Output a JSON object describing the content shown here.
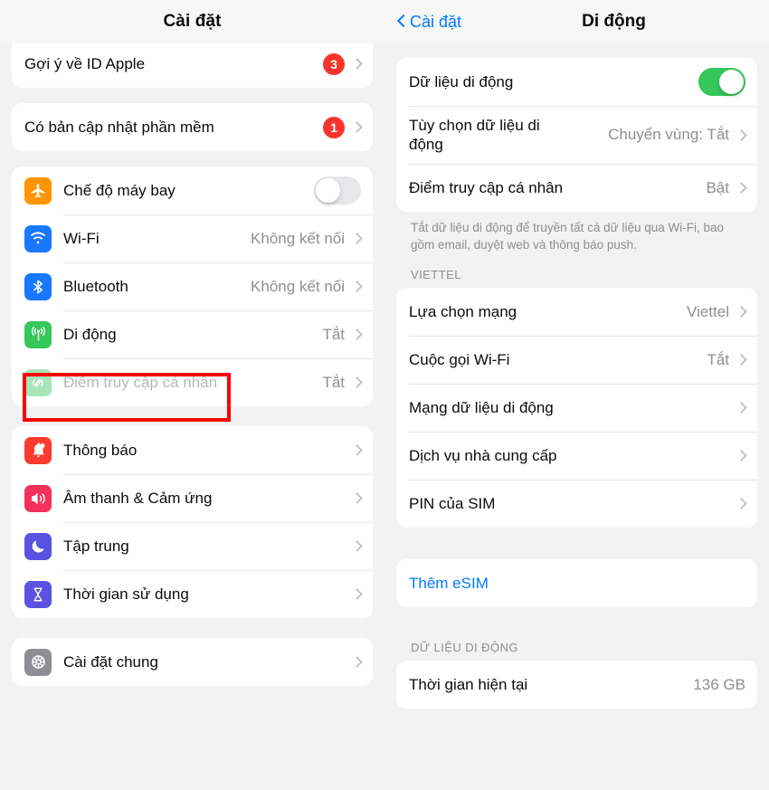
{
  "left_panel": {
    "nav": {
      "title": "Cài đặt"
    },
    "groups": [
      {
        "name": "apple-id-suggestion",
        "rows": [
          {
            "label": "Gợi ý về ID Apple",
            "badge": "3",
            "chevron": true
          }
        ]
      },
      {
        "name": "software-update",
        "rows": [
          {
            "label": "Có bản cập nhật phần mềm",
            "badge": "1",
            "chevron": true
          }
        ]
      },
      {
        "name": "connectivity",
        "rows": [
          {
            "label": "Chế độ máy bay",
            "icon": "airplane-icon",
            "toggle": "off"
          },
          {
            "label": "Wi-Fi",
            "icon": "wifi-icon",
            "value": "Không kết nối",
            "chevron": true
          },
          {
            "label": "Bluetooth",
            "icon": "bluetooth-icon",
            "value": "Không kết nối",
            "chevron": true
          },
          {
            "label": "Di động",
            "icon": "cellular-icon",
            "value": "Tắt",
            "chevron": true
          },
          {
            "label": "Điểm truy cập cá nhân",
            "icon": "hotspot-icon",
            "value": "Tắt",
            "chevron": true,
            "dim": true
          }
        ]
      },
      {
        "name": "notifications",
        "rows": [
          {
            "label": "Thông báo",
            "icon": "bell-icon",
            "chevron": true
          },
          {
            "label": "Âm thanh & Cảm ứng",
            "icon": "speaker-icon",
            "chevron": true
          },
          {
            "label": "Tập trung",
            "icon": "moon-icon",
            "chevron": true
          },
          {
            "label": "Thời gian sử dụng",
            "icon": "hourglass-icon",
            "chevron": true
          }
        ]
      },
      {
        "name": "general",
        "rows": [
          {
            "label": "Cài đặt chung",
            "icon": "gear-icon",
            "chevron": true
          }
        ]
      }
    ]
  },
  "right_panel": {
    "nav": {
      "back_label": "Cài đặt",
      "title": "Di động"
    },
    "groups": [
      {
        "name": "cellular-data",
        "rows": [
          {
            "label": "Dữ liệu di động",
            "toggle": "on"
          },
          {
            "label": "Tùy chọn dữ liệu di động",
            "value": "Chuyển vùng: Tắt",
            "chevron": true,
            "two_line": true
          },
          {
            "label": "Điểm truy cập cá nhân",
            "value": "Bật",
            "chevron": true
          }
        ],
        "footnote": "Tắt dữ liệu di động để truyền tất cả dữ liệu qua Wi-Fi, bao gồm email, duyệt web và thông báo push."
      },
      {
        "name": "viettel",
        "header": "VIETTEL",
        "rows": [
          {
            "label": "Lựa chọn mạng",
            "value": "Viettel",
            "chevron": true
          },
          {
            "label": "Cuộc gọi Wi-Fi",
            "value": "Tắt",
            "chevron": true
          },
          {
            "label": "Mạng dữ liệu di động",
            "chevron": true
          },
          {
            "label": "Dịch vụ nhà cung cấp",
            "chevron": true
          },
          {
            "label": "PIN của SIM",
            "chevron": true
          }
        ]
      },
      {
        "name": "add-esim",
        "rows": [
          {
            "label": "Thêm eSIM",
            "link": true
          }
        ]
      },
      {
        "name": "data-usage",
        "header": "DỮ LIỆU DI ĐỘNG",
        "rows": [
          {
            "label": "Thời gian hiện tại",
            "value": "136 GB"
          }
        ]
      }
    ]
  },
  "highlights": [
    {
      "name": "mobile-row-highlight",
      "color": "#ff0000"
    },
    {
      "name": "cellular-data-row-highlight",
      "color": "#ff0000"
    }
  ],
  "colors": {
    "accent_blue": "#007aff",
    "toggle_on_green": "#35c759",
    "badge_red": "#f8352c",
    "highlight_red": "#ff0000",
    "page_bg": "#f2f2f2",
    "card_bg": "#ffffff",
    "secondary_text": "#8e8e93"
  }
}
